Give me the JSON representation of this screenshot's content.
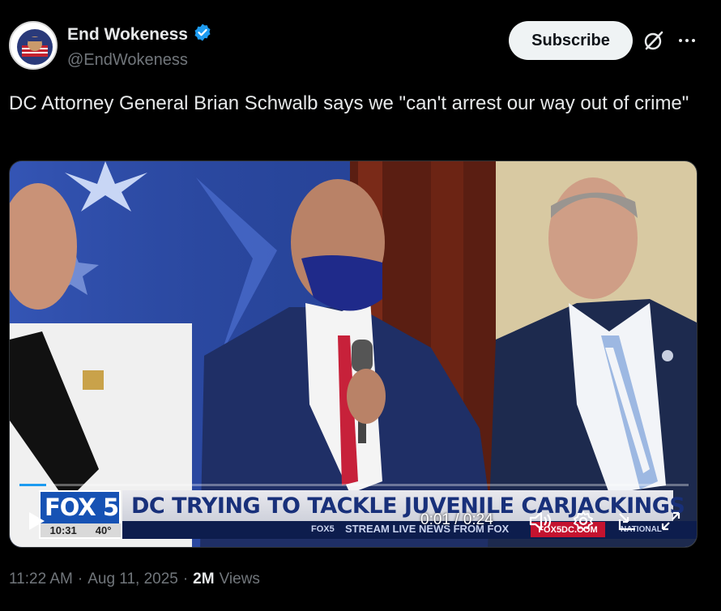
{
  "author": {
    "display_name": "End Wokeness",
    "handle": "@EndWokeness",
    "verified": true,
    "avatar_text": "I SUPPORT THE FORMER THINGS"
  },
  "actions": {
    "subscribe_label": "Subscribe",
    "grok_icon": "grok-icon",
    "more_icon": "more-icon"
  },
  "tweet": {
    "text": "DC Attorney General Brian Schwalb says we \"can't arrest our way out of crime\""
  },
  "video": {
    "channel_logo": "FOX 5",
    "clock": "10:31",
    "temperature": "40°",
    "headline": "DC TRYING TO TACKLE JUVENILE CARJACKINGS",
    "ticker_brand": "FOX5",
    "ticker_text": "STREAM LIVE NEWS FROM FOX",
    "ticker_site": "FOX5DC.COM",
    "ticker_tag": "NATIONAL",
    "current_time": "0:01",
    "duration": "0:24",
    "time_display": "0:01 / 0:24",
    "progress_fraction": 0.04
  },
  "meta": {
    "time": "11:22 AM",
    "date": "Aug 11, 2025",
    "views_count": "2M",
    "views_label": "Views"
  },
  "colors": {
    "accent": "#1d9bf0",
    "subscribe_bg": "#eff3f4",
    "muted": "#71767b",
    "fox_blue": "#1652b4"
  }
}
